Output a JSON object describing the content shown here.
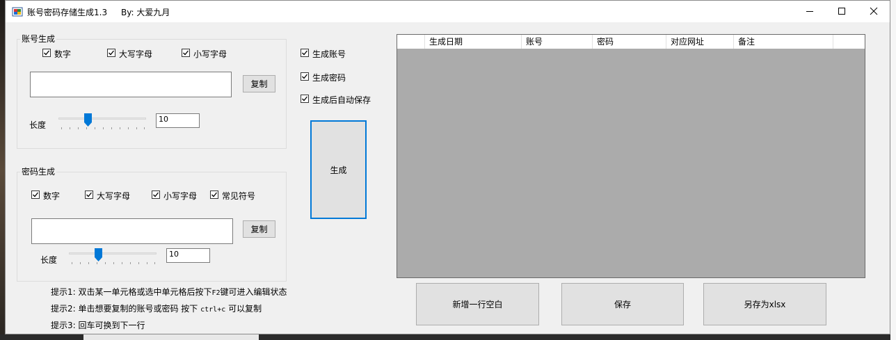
{
  "window": {
    "title": "账号密码存储生成1.3",
    "author": "By: 大爱九月",
    "controls": [
      "minimize-icon",
      "maximize-icon",
      "close-icon"
    ]
  },
  "account_group": {
    "title": "账号生成",
    "options": [
      {
        "label": "数字",
        "checked": true
      },
      {
        "label": "大写字母",
        "checked": true
      },
      {
        "label": "小写字母",
        "checked": true
      }
    ],
    "output_value": "",
    "copy_label": "复制",
    "length_label": "长度",
    "length_value": "10",
    "slider_fraction": 0.35
  },
  "password_group": {
    "title": "密码生成",
    "options": [
      {
        "label": "数字",
        "checked": true
      },
      {
        "label": "大写字母",
        "checked": true
      },
      {
        "label": "小写字母",
        "checked": true
      },
      {
        "label": "常见符号",
        "checked": true
      }
    ],
    "output_value": "",
    "copy_label": "复制",
    "length_label": "长度",
    "length_value": "10",
    "slider_fraction": 0.35
  },
  "generate_options": [
    {
      "label": "生成账号",
      "checked": true
    },
    {
      "label": "生成密码",
      "checked": true
    },
    {
      "label": "生成后自动保存",
      "checked": true
    }
  ],
  "generate_button": "生成",
  "table": {
    "columns": [
      "",
      "生成日期",
      "账号",
      "密码",
      "对应网址",
      "备注"
    ],
    "rows": []
  },
  "hints": [
    {
      "prefix": "提示1: 双击某一单元格或选中单元格后按下",
      "mono": "F2",
      "suffix": "键可进入编辑状态"
    },
    {
      "prefix": "提示2: 单击想要复制的账号或密码 按下 ",
      "mono": "ctrl+c",
      "suffix": " 可以复制"
    },
    {
      "prefix": "提示3: 回车可换到下一行",
      "mono": "",
      "suffix": ""
    }
  ],
  "actions": {
    "add_row": "新增一行空白",
    "save": "保存",
    "save_as": "另存为xlsx"
  },
  "colors": {
    "accent": "#0078d7",
    "grid_background": "#ababab",
    "window_background": "#f0f0f0"
  }
}
